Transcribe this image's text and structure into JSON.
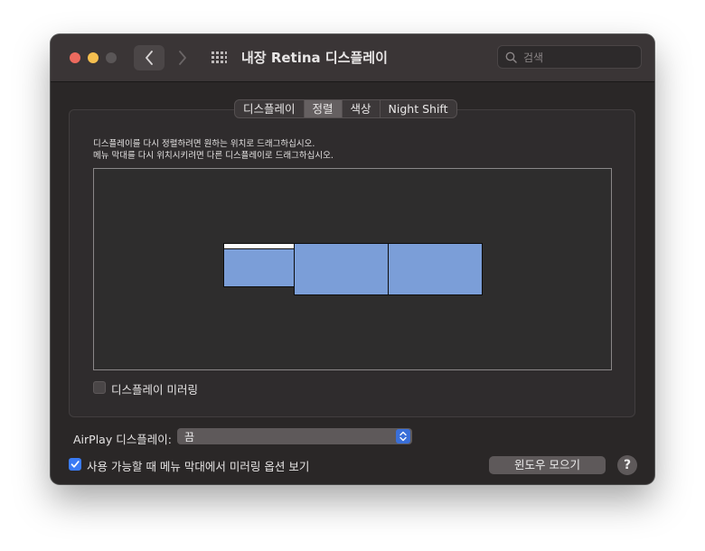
{
  "window": {
    "title": "내장 Retina 디스플레이",
    "search_placeholder": "검색"
  },
  "tabs": [
    {
      "label": "디스플레이",
      "active": false
    },
    {
      "label": "정렬",
      "active": true
    },
    {
      "label": "색상",
      "active": false
    },
    {
      "label": "Night Shift",
      "active": false
    }
  ],
  "instructions": {
    "line1": "디스플레이를 다시 정렬하려면 원하는 위치로 드래그하십시오.",
    "line2": "메뉴 막대를 다시 위치시키려면 다른 디스플레이로 드래그하십시오."
  },
  "mirroring": {
    "label": "디스플레이 미러링",
    "checked": false
  },
  "airplay": {
    "label": "AirPlay 디스플레이:",
    "value": "끔"
  },
  "menubar_option": {
    "label": "사용 가능할 때 메뉴 막대에서 미러링 옵션 보기",
    "checked": true
  },
  "buttons": {
    "gather_windows": "윈도우 모으기",
    "help": "?"
  },
  "colors": {
    "accent": "#3a7bf5",
    "display_fill": "#7b9ed8",
    "window_bg": "#2a2727"
  }
}
